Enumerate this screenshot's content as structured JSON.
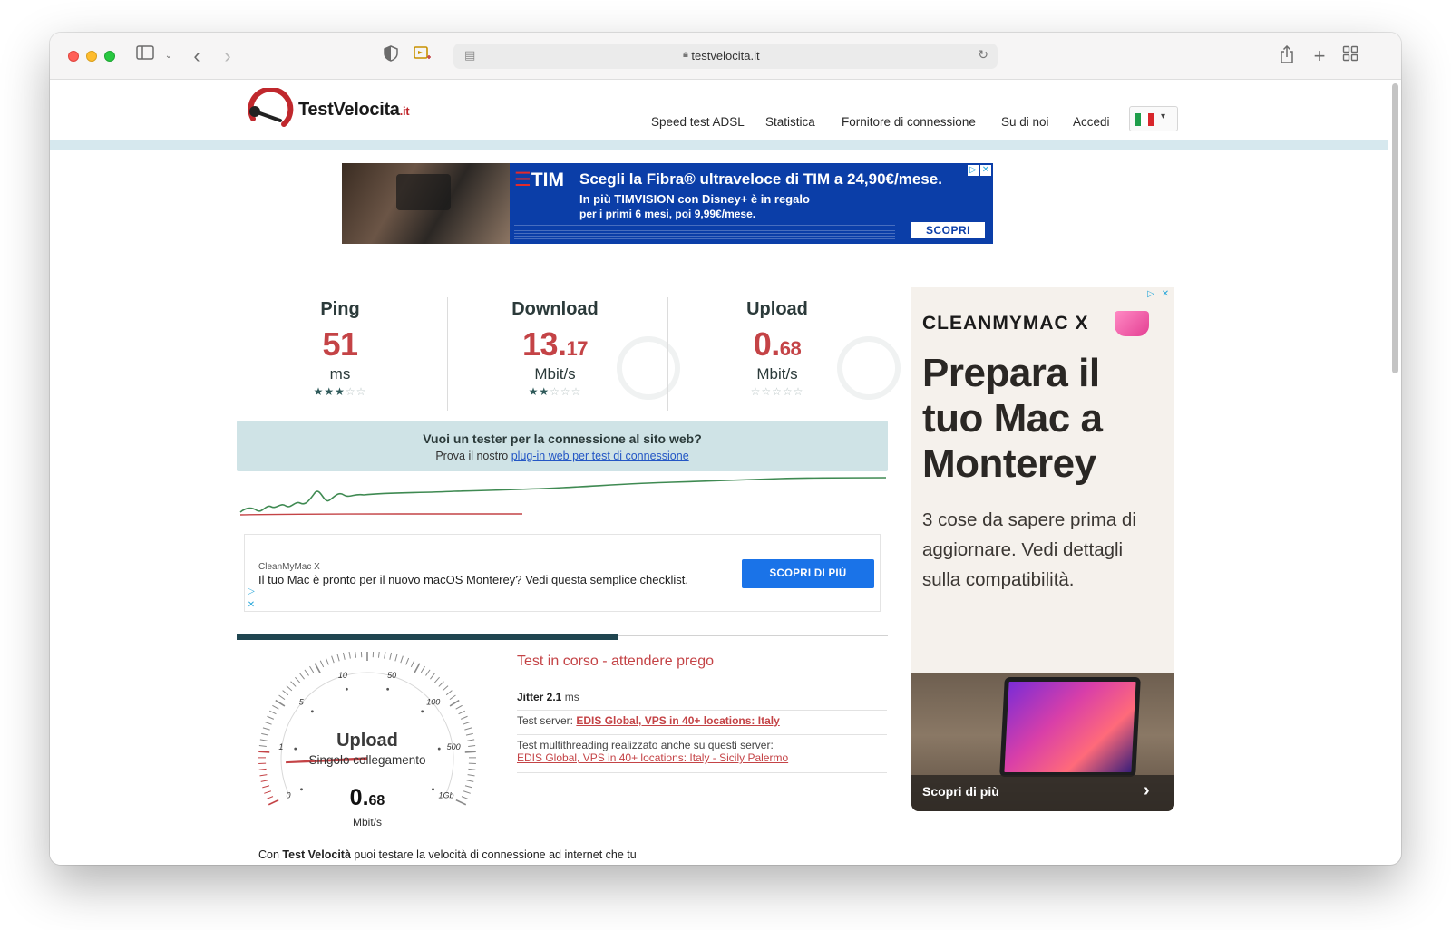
{
  "browser": {
    "url": "testvelocita.it"
  },
  "site": {
    "logo_name": "TestVelocita",
    "logo_tld": ".it",
    "nav": [
      "Speed test ADSL",
      "Statistica",
      "Fornitore di connessione",
      "Su di noi",
      "Accedi"
    ],
    "lang_flag": "italy-flag"
  },
  "banner_ad": {
    "brand": "TIM",
    "line1": "Scegli la Fibra® ultraveloce di TIM a 24,90€/mese.",
    "line2": "In più TIMVISION con Disney+ è in regalo",
    "line3": "per i primi 6 mesi, poi 9,99€/mese.",
    "cta": "SCOPRI"
  },
  "metrics": [
    {
      "label": "Ping",
      "value_big": "51",
      "value_small": "",
      "unit": "ms",
      "stars_on": 3,
      "stars_total": 5
    },
    {
      "label": "Download",
      "value_big": "13.",
      "value_small": "17",
      "unit": "Mbit/s",
      "stars_on": 2,
      "stars_total": 5
    },
    {
      "label": "Upload",
      "value_big": "0.",
      "value_small": "68",
      "unit": "Mbit/s",
      "stars_on": 0,
      "stars_total": 5
    }
  ],
  "info_box": {
    "question": "Vuoi un tester per la connessione al sito web?",
    "prefix": "Prova il nostro ",
    "link": "plug-in web per test di connessione"
  },
  "text_ad": {
    "advertiser": "CleanMyMac X",
    "message": "Il tuo Mac è pronto per il nuovo macOS Monterey? Vedi questa semplice checklist.",
    "cta": "SCOPRI DI PIÙ"
  },
  "progress": {
    "fraction": 0.585
  },
  "gauge": {
    "title": "Upload",
    "subtitle": "Singolo collegamento",
    "value_big": "0.",
    "value_small": "68",
    "unit": "Mbit/s",
    "scale_labels": [
      "0",
      "1",
      "5",
      "10",
      "50",
      "100",
      "500",
      "1Gb"
    ],
    "needle_value": 0.68
  },
  "test": {
    "status": "Test in corso - attendere prego",
    "jitter_label": "Jitter 2.1",
    "jitter_unit": " ms",
    "server_label": "Test server: ",
    "server_link": "EDIS Global, VPS in 40+ locations: Italy",
    "multi_label": "Test multithreading realizzato anche su questi server:",
    "multi_link": "EDIS Global, VPS in 40+ locations: Italy - Sicily Palermo"
  },
  "footer": {
    "pre": "Con ",
    "bold": "Test Velocità",
    "post": " puoi testare la velocità di connessione ad internet che tu disponga di un piano ADSL e fibra ottica."
  },
  "side_ad": {
    "brand": "CLEANMYMAC X",
    "headline": "Prepara il tuo Mac a Monterey",
    "body": "3 cose da sapere prima di aggiornare. Vedi dettagli sulla compatibilità.",
    "cta": "Scopri di più"
  },
  "colors": {
    "accent_red": "#c44346",
    "dark_teal": "#1f4550",
    "info_bg": "#cfe3e6",
    "graph_green": "#3f8a52",
    "graph_red": "#c44346",
    "tim_blue": "#0b3ea8"
  }
}
